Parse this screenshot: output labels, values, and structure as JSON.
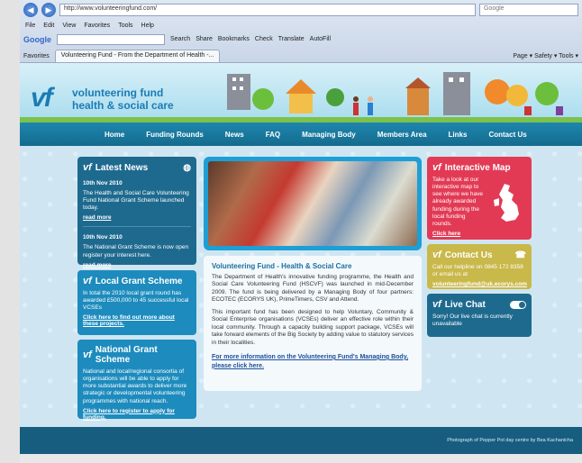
{
  "browser": {
    "address": "http://www.volunteeringfund.com/",
    "search_placeholder": "Google",
    "menu": [
      "File",
      "Edit",
      "View",
      "Favorites",
      "Tools",
      "Help"
    ],
    "toolbar": {
      "google": "Google",
      "search": "Search",
      "share": "Share",
      "bookmarks": "Bookmarks",
      "check": "Check",
      "translate": "Translate",
      "autofill": "AutoFill"
    },
    "favorites_label": "Favorites",
    "tab_title": "Volunteering Fund - From the Department of Health -...",
    "tab_tools": "Page ▾  Safety ▾  Tools ▾"
  },
  "site": {
    "logo_mark": "vf",
    "logo_line1": "volunteering fund",
    "logo_line2": "health & social care",
    "nav": [
      "Home",
      "Funding Rounds",
      "News",
      "FAQ",
      "Managing Body",
      "Members Area",
      "Links",
      "Contact Us"
    ],
    "news": {
      "title": "Latest News",
      "items": [
        {
          "date": "10th Nov 2010",
          "text": "The Health and Social Care Volunteering Fund National Grant Scheme launched today.",
          "link": "read more"
        },
        {
          "date": "10th Nov 2010",
          "text": "The National Grant Scheme is now open register your interest here.",
          "link": "read more"
        }
      ]
    },
    "local": {
      "title": "Local Grant Scheme",
      "text": "In total the 2010 local grant round has awarded £500,000 to 45 successful local VCSEs",
      "link": "Click here to find out more about these projects."
    },
    "national": {
      "title": "National Grant Scheme",
      "text": "National and local/regional consortia of organisations will be able to apply for more substantial awards to deliver more strategic or developmental volunteering programmes with national reach.",
      "link": "Click here to register to apply for funding."
    },
    "content": {
      "heading": "Volunteering Fund - Health & Social Care",
      "para1": "The Department of Health's innovative funding programme, the Health and Social Care Volunteering Fund (HSCVF) was launched in mid-December 2009. The fund is being delivered by a Managing Body of four partners: ECOTEC (ECORYS UK), PrimeTimers, CSV and Attend.",
      "para2": "This important fund has been designed to help Voluntary, Community & Social Enterprise organisations (VCSEs) deliver an effective role within their local community. Through a capacity building support package, VCSEs will take forward elements of the Big Society by adding value to statutory services in their localities.",
      "more": "For more information on the Volunteering Fund's Managing Body, please click here."
    },
    "map": {
      "title": "Interactive Map",
      "text": "Take a look at our interactive map to see where we have already awarded funding during the local funding rounds.",
      "link": "Click here"
    },
    "contact": {
      "title": "Contact Us",
      "text": "Call our helpline on 0845 172 8358 or email us at",
      "email": "volunteeringfund@uk.ecorys.com"
    },
    "chat": {
      "title": "Live Chat",
      "text": "Sorry! Our live chat is currently unavailable"
    },
    "footer_credit": "Photograph of Pepper Pot day centre by Bea Kachanicha"
  },
  "colors": {
    "brand_blue": "#1c7bb5",
    "nav": "#1a7aa0",
    "map_red": "#e23a55",
    "contact_gold": "#c9b84a"
  }
}
